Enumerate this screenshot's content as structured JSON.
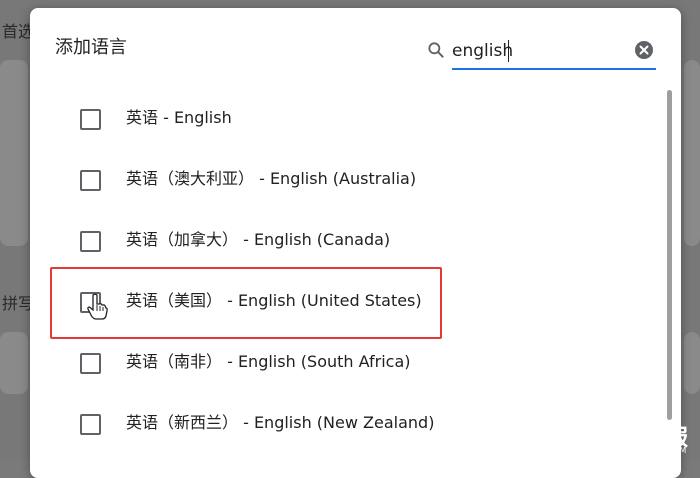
{
  "background": {
    "label_1": "首选",
    "label_2": "拼写"
  },
  "dialog": {
    "title": "添加语言",
    "search": {
      "value": "english",
      "icon": "search-icon",
      "clear_icon": "clear-icon"
    },
    "languages": [
      {
        "label": "英语 - English",
        "checked": false
      },
      {
        "label": "英语（澳大利亚） - English (Australia)",
        "checked": false
      },
      {
        "label": "英语（加拿大） - English (Canada)",
        "checked": false
      },
      {
        "label": "英语（美国） - English (United States)",
        "checked": false,
        "highlighted": true
      },
      {
        "label": "英语（南非） - English (South Africa)",
        "checked": false
      },
      {
        "label": "英语（新西兰） - English (New Zealand)",
        "checked": false
      }
    ]
  },
  "watermark": {
    "text": "去外服",
    "subtext": "QUWAIFU.COM"
  },
  "colors": {
    "accent": "#1a73e8",
    "highlight_border": "#e53935",
    "text": "#202124"
  }
}
